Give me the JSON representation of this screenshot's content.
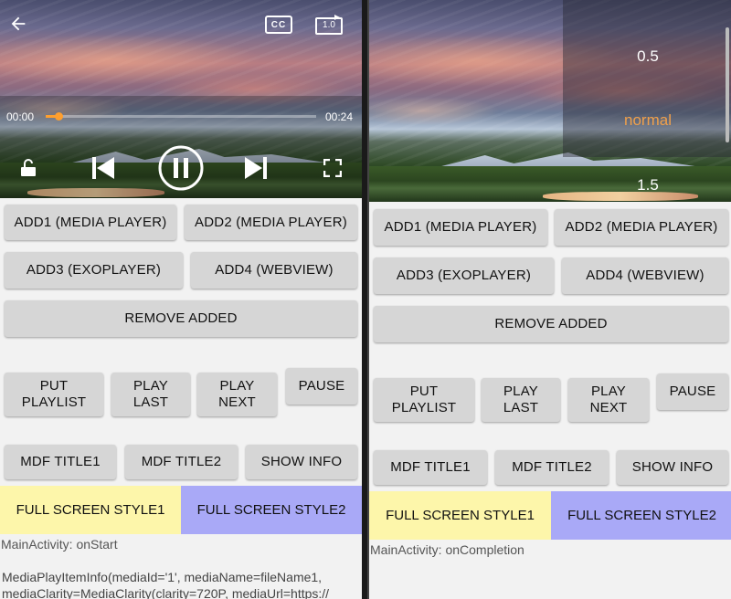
{
  "left": {
    "player": {
      "time_current": "00:00",
      "time_total": "00:24",
      "progress": 0.0,
      "cc_label": "CC",
      "speed_badge": "1.0"
    },
    "buttons": {
      "add1": "ADD1 (MEDIA PLAYER)",
      "add2": "ADD2 (MEDIA PLAYER)",
      "add3": "ADD3 (EXOPLAYER)",
      "add4": "ADD4 (WEBVIEW)",
      "remove": "REMOVE ADDED",
      "put_playlist_1": "PUT",
      "put_playlist_2": "PLAYLIST",
      "play_last_1": "PLAY",
      "play_last_2": "LAST",
      "play_next_1": "PLAY",
      "play_next_2": "NEXT",
      "pause": "PAUSE",
      "mdf_title1": "MDF TITLE1",
      "mdf_title2": "MDF TITLE2",
      "show_info": "SHOW INFO",
      "full_screen_1": "FULL SCREEN STYLE1",
      "full_screen_2": "FULL SCREEN STYLE2"
    },
    "log_status": "MainActivity: onStart",
    "log_info_1": " MediaPlayItemInfo(mediaId='1', mediaName=fileName1,",
    "log_info_2": "mediaClarity=MediaClarity(clarity=720P, mediaUrl=https://"
  },
  "right": {
    "speed_options": [
      "0.5",
      "normal",
      "1.5"
    ],
    "selected_speed": "normal",
    "buttons": {
      "add1": "ADD1 (MEDIA PLAYER)",
      "add2": "ADD2 (MEDIA PLAYER)",
      "add3": "ADD3 (EXOPLAYER)",
      "add4": "ADD4 (WEBVIEW)",
      "remove": "REMOVE ADDED",
      "put_playlist_1": "PUT",
      "put_playlist_2": "PLAYLIST",
      "play_last_1": "PLAY",
      "play_last_2": "LAST",
      "play_next_1": "PLAY",
      "play_next_2": "NEXT",
      "pause": "PAUSE",
      "mdf_title1": "MDF TITLE1",
      "mdf_title2": "MDF TITLE2",
      "show_info": "SHOW INFO",
      "full_screen_1": "FULL SCREEN STYLE1",
      "full_screen_2": "FULL SCREEN STYLE2"
    },
    "log_status": "MainActivity: onCompletion"
  },
  "colors": {
    "accent": "#ff9f2e",
    "speed_selected": "#f0a04b",
    "fullscreen1_bg": "#fdf6aa",
    "fullscreen2_bg": "#a9a9f7",
    "button_bg": "#d6d6d6"
  },
  "icons": [
    "back-arrow-icon",
    "closed-caption-icon",
    "playback-speed-icon",
    "unlock-icon",
    "skip-previous-icon",
    "pause-icon",
    "skip-next-icon",
    "fullscreen-icon"
  ]
}
